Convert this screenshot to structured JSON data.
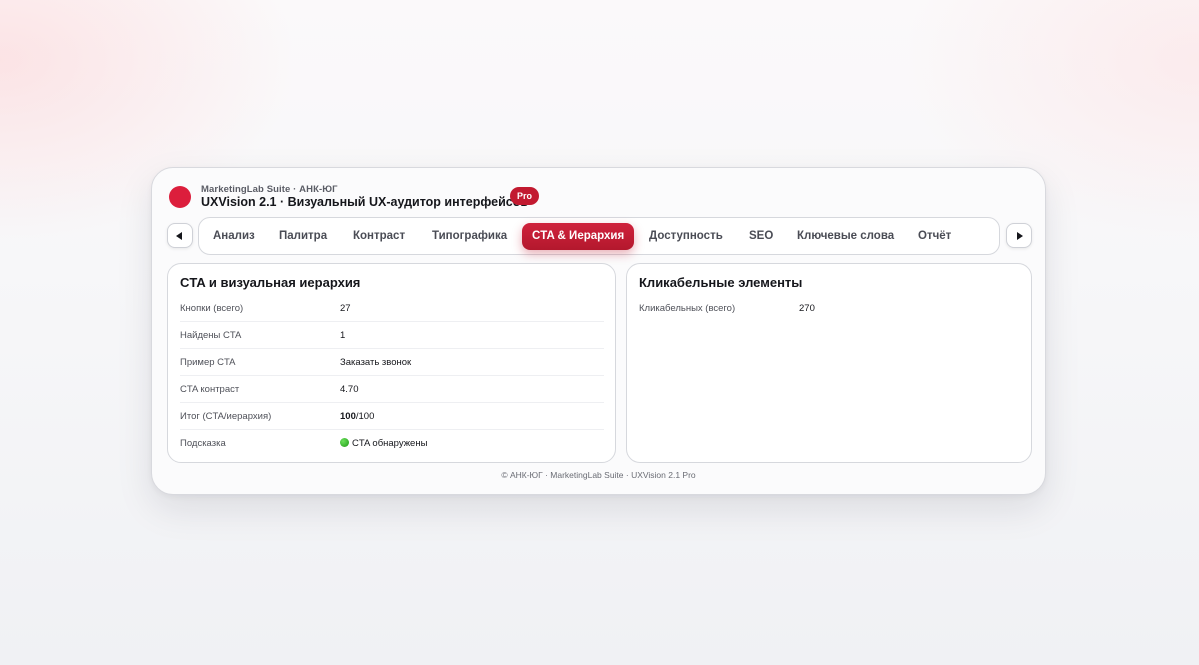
{
  "header": {
    "suite_label": "MarketingLab Suite · АНК-ЮГ",
    "title": "UXVision 2.1 · Визуальный UX-аудитор интерфейсов",
    "badge": "Pro",
    "brand_color": "#dc1e3c"
  },
  "nav": {
    "prev_icon": "triangle-left-icon",
    "next_icon": "triangle-right-icon",
    "active_tab": "CTA & Иерархия",
    "tabs": [
      "Анализ",
      "Палитра",
      "Контраст",
      "Типографика",
      "CTA & Иерархия",
      "Доступность",
      "SEO",
      "Ключевые слова",
      "Отчёт"
    ]
  },
  "cta_panel": {
    "title": "CTA и визуальная иерархия",
    "rows": [
      {
        "label": "Кнопки (всего)",
        "value": "27"
      },
      {
        "label": "Найдены CTA",
        "value": "1"
      },
      {
        "label": "Пример CTA",
        "value": "Заказать звонок"
      },
      {
        "label": "CTA контраст",
        "value": "4.70"
      },
      {
        "label": "Итог (CTA/иерархия)",
        "value_bold": "100",
        "value_rest": "/100"
      },
      {
        "label": "Подсказка",
        "value": "CTA обнаружены",
        "status_color": "#2ab523"
      }
    ]
  },
  "clickable_panel": {
    "title": "Кликабельные элементы",
    "rows": [
      {
        "label": "Кликабельных (всего)",
        "value": "270"
      }
    ]
  },
  "footer": {
    "text": "© АНК-ЮГ · MarketingLab Suite · UXVision 2.1 Pro"
  }
}
